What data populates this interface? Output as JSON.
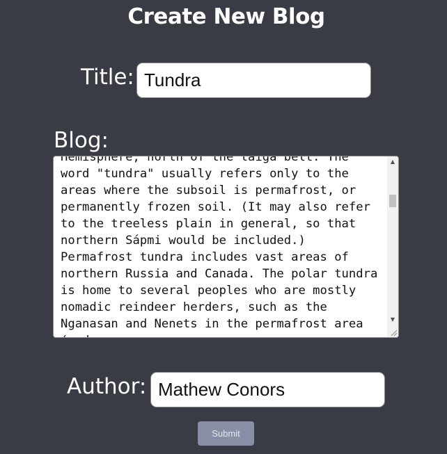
{
  "page": {
    "title": "Create New Blog"
  },
  "form": {
    "title_label": "Title:",
    "title_value": "Tundra",
    "blog_label": "Blog:",
    "blog_text": "Hemisphere, north of the taiga belt. The word \"tundra\" usually refers only to the areas where the subsoil is permafrost, or permanently frozen soil. (It may also refer to the treeless plain in general, so that northern Sápmi would be included.) Permafrost tundra includes vast areas of northern Russia and Canada. The polar tundra is home to several peoples who are mostly nomadic reindeer herders, such as the Nganasan and Nenets in the permafrost area (and",
    "author_label": "Author:",
    "author_value": "Mathew Conors",
    "submit_label": "Submit"
  },
  "colors": {
    "background": "#393b45",
    "text": "#ffffff",
    "submit_bg": "#8a8ea5"
  },
  "icons": {
    "scroll_up": "arrow-up-icon",
    "scroll_down": "arrow-down-icon",
    "resize": "resize-grip-icon"
  }
}
